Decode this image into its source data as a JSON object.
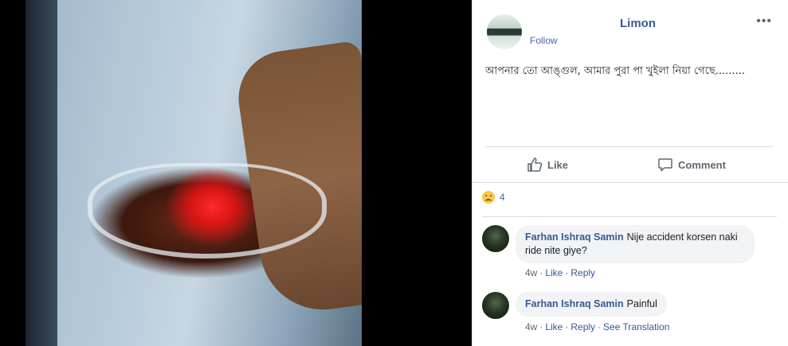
{
  "post": {
    "page_name": "Limon",
    "follow_label": "Follow",
    "more_label": "•••",
    "text": "আপনার তো আঙ্গুল, আমার পুরা পা খুইলা নিয়া গেছে.........",
    "actions": {
      "like_label": "Like",
      "comment_label": "Comment"
    },
    "reactions": {
      "icon": "sad-reaction-icon",
      "count": "4"
    }
  },
  "comments": [
    {
      "author": "Farhan Ishraq Samin",
      "text": "Nije accident korsen naki ride nite giye?",
      "time": "4w",
      "like": "Like",
      "reply": "Reply"
    },
    {
      "author": "Farhan Ishraq Samin",
      "text": "Painful",
      "time": "4w",
      "like": "Like",
      "reply": "Reply",
      "translate": "See Translation"
    }
  ],
  "colors": {
    "link": "#385898",
    "bubble": "#f2f3f5",
    "page_name": "#365899"
  }
}
